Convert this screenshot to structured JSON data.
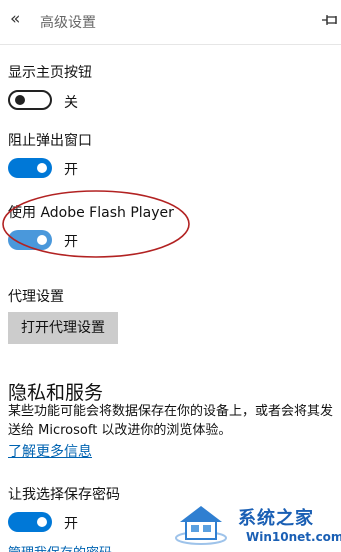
{
  "header": {
    "title": "高级设置",
    "back_icon": "chevron-double-left-icon",
    "pin_icon": "pin-icon"
  },
  "settings": [
    {
      "label": "显示主页按钮",
      "state": "关",
      "on": false
    },
    {
      "label": "阻止弹出窗口",
      "state": "开",
      "on": true
    },
    {
      "label": "使用 Adobe Flash Player",
      "state": "开",
      "on": true
    }
  ],
  "proxy": {
    "label": "代理设置",
    "button": "打开代理设置"
  },
  "privacy": {
    "title": "隐私和服务",
    "description_line1": "某些功能可能会将数据保存在你的设备上，或者会将其发",
    "description_line2": "送给 Microsoft 以改进你的浏览体验。",
    "learn_more": "了解更多信息"
  },
  "passwords": {
    "label": "让我选择保存密码",
    "state": "开",
    "on": true,
    "manage_link": "管理我保存的密码"
  },
  "watermark": {
    "text": "系统之家",
    "subtext": "Win10net.com"
  },
  "colors": {
    "accent": "#0078d7",
    "link": "#0063b1",
    "annotation": "#b22222"
  }
}
